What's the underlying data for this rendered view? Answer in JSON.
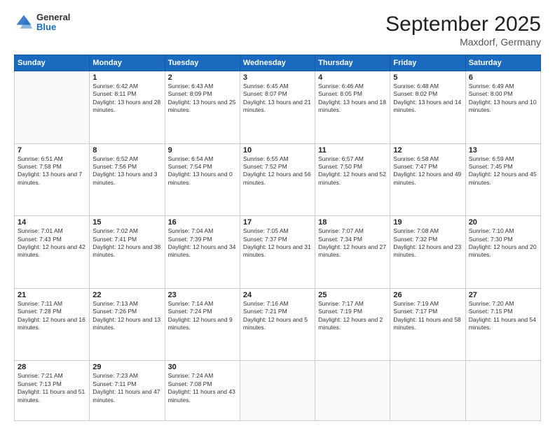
{
  "header": {
    "logo": {
      "general": "General",
      "blue": "Blue"
    },
    "title": "September 2025",
    "location": "Maxdorf, Germany"
  },
  "days_header": [
    "Sunday",
    "Monday",
    "Tuesday",
    "Wednesday",
    "Thursday",
    "Friday",
    "Saturday"
  ],
  "weeks": [
    [
      {
        "day": "",
        "info": ""
      },
      {
        "day": "1",
        "info": "Sunrise: 6:42 AM\nSunset: 8:11 PM\nDaylight: 13 hours and 28 minutes."
      },
      {
        "day": "2",
        "info": "Sunrise: 6:43 AM\nSunset: 8:09 PM\nDaylight: 13 hours and 25 minutes."
      },
      {
        "day": "3",
        "info": "Sunrise: 6:45 AM\nSunset: 8:07 PM\nDaylight: 13 hours and 21 minutes."
      },
      {
        "day": "4",
        "info": "Sunrise: 6:46 AM\nSunset: 8:05 PM\nDaylight: 13 hours and 18 minutes."
      },
      {
        "day": "5",
        "info": "Sunrise: 6:48 AM\nSunset: 8:02 PM\nDaylight: 13 hours and 14 minutes."
      },
      {
        "day": "6",
        "info": "Sunrise: 6:49 AM\nSunset: 8:00 PM\nDaylight: 13 hours and 10 minutes."
      }
    ],
    [
      {
        "day": "7",
        "info": "Sunrise: 6:51 AM\nSunset: 7:58 PM\nDaylight: 13 hours and 7 minutes."
      },
      {
        "day": "8",
        "info": "Sunrise: 6:52 AM\nSunset: 7:56 PM\nDaylight: 13 hours and 3 minutes."
      },
      {
        "day": "9",
        "info": "Sunrise: 6:54 AM\nSunset: 7:54 PM\nDaylight: 13 hours and 0 minutes."
      },
      {
        "day": "10",
        "info": "Sunrise: 6:55 AM\nSunset: 7:52 PM\nDaylight: 12 hours and 56 minutes."
      },
      {
        "day": "11",
        "info": "Sunrise: 6:57 AM\nSunset: 7:50 PM\nDaylight: 12 hours and 52 minutes."
      },
      {
        "day": "12",
        "info": "Sunrise: 6:58 AM\nSunset: 7:47 PM\nDaylight: 12 hours and 49 minutes."
      },
      {
        "day": "13",
        "info": "Sunrise: 6:59 AM\nSunset: 7:45 PM\nDaylight: 12 hours and 45 minutes."
      }
    ],
    [
      {
        "day": "14",
        "info": "Sunrise: 7:01 AM\nSunset: 7:43 PM\nDaylight: 12 hours and 42 minutes."
      },
      {
        "day": "15",
        "info": "Sunrise: 7:02 AM\nSunset: 7:41 PM\nDaylight: 12 hours and 38 minutes."
      },
      {
        "day": "16",
        "info": "Sunrise: 7:04 AM\nSunset: 7:39 PM\nDaylight: 12 hours and 34 minutes."
      },
      {
        "day": "17",
        "info": "Sunrise: 7:05 AM\nSunset: 7:37 PM\nDaylight: 12 hours and 31 minutes."
      },
      {
        "day": "18",
        "info": "Sunrise: 7:07 AM\nSunset: 7:34 PM\nDaylight: 12 hours and 27 minutes."
      },
      {
        "day": "19",
        "info": "Sunrise: 7:08 AM\nSunset: 7:32 PM\nDaylight: 12 hours and 23 minutes."
      },
      {
        "day": "20",
        "info": "Sunrise: 7:10 AM\nSunset: 7:30 PM\nDaylight: 12 hours and 20 minutes."
      }
    ],
    [
      {
        "day": "21",
        "info": "Sunrise: 7:11 AM\nSunset: 7:28 PM\nDaylight: 12 hours and 16 minutes."
      },
      {
        "day": "22",
        "info": "Sunrise: 7:13 AM\nSunset: 7:26 PM\nDaylight: 12 hours and 13 minutes."
      },
      {
        "day": "23",
        "info": "Sunrise: 7:14 AM\nSunset: 7:24 PM\nDaylight: 12 hours and 9 minutes."
      },
      {
        "day": "24",
        "info": "Sunrise: 7:16 AM\nSunset: 7:21 PM\nDaylight: 12 hours and 5 minutes."
      },
      {
        "day": "25",
        "info": "Sunrise: 7:17 AM\nSunset: 7:19 PM\nDaylight: 12 hours and 2 minutes."
      },
      {
        "day": "26",
        "info": "Sunrise: 7:19 AM\nSunset: 7:17 PM\nDaylight: 11 hours and 58 minutes."
      },
      {
        "day": "27",
        "info": "Sunrise: 7:20 AM\nSunset: 7:15 PM\nDaylight: 11 hours and 54 minutes."
      }
    ],
    [
      {
        "day": "28",
        "info": "Sunrise: 7:21 AM\nSunset: 7:13 PM\nDaylight: 11 hours and 51 minutes."
      },
      {
        "day": "29",
        "info": "Sunrise: 7:23 AM\nSunset: 7:11 PM\nDaylight: 11 hours and 47 minutes."
      },
      {
        "day": "30",
        "info": "Sunrise: 7:24 AM\nSunset: 7:08 PM\nDaylight: 11 hours and 43 minutes."
      },
      {
        "day": "",
        "info": ""
      },
      {
        "day": "",
        "info": ""
      },
      {
        "day": "",
        "info": ""
      },
      {
        "day": "",
        "info": ""
      }
    ]
  ]
}
